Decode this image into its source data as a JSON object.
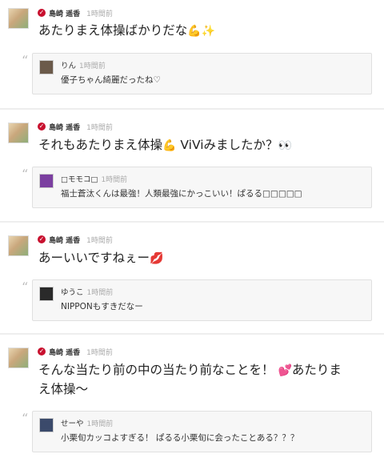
{
  "posts": [
    {
      "author": "島崎 遥香",
      "time": "1時間前",
      "text": "あたりまえ体操ばかりだな",
      "emojis": [
        "💪",
        "✨"
      ],
      "comment": {
        "author": "りん",
        "time": "1時間前",
        "text": "優子ちゃん綺麗だったね♡",
        "avatar_color": "#6b5a4a"
      }
    },
    {
      "author": "島崎 遥香",
      "time": "1時間前",
      "text": "それもあたりまえ体操",
      "text_after": " ViViみましたか？",
      "emojis": [
        "💪",
        "👀"
      ],
      "comment": {
        "author": "□モモコ□",
        "time": "1時間前",
        "text": "福士蒼汰くんは最強！人類最強にかっこいい！ぱるる□□□□□",
        "avatar_color": "#7b3fa0"
      }
    },
    {
      "author": "島崎 遥香",
      "time": "1時間前",
      "text": "あーいいですねぇー",
      "emojis": [
        "💋"
      ],
      "comment": {
        "author": "ゆうこ",
        "time": "1時間前",
        "text": "NIPPONもすきだなー",
        "avatar_color": "#2a2a2a"
      }
    },
    {
      "author": "島崎 遥香",
      "time": "1時間前",
      "text": "そんな当たり前の中の当たり前なことを！",
      "text_after": "あたりまえ体操〜",
      "emojis": [
        "💕"
      ],
      "comment": {
        "author": "せーや",
        "time": "1時間前",
        "text": "小栗旬カッコよすぎる！ ぱるる小栗旬に会ったことある？？？",
        "avatar_color": "#3b4a6b"
      }
    }
  ]
}
